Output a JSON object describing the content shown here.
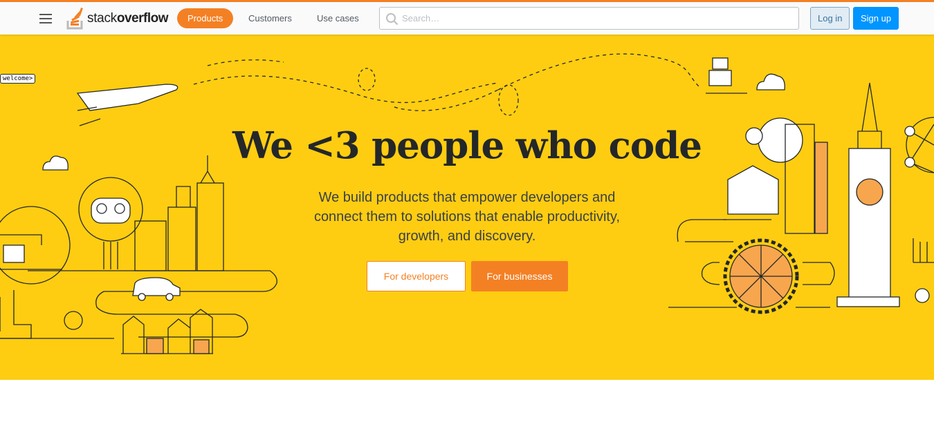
{
  "header": {
    "logo": {
      "part1": "stack",
      "part2": "overflow"
    },
    "nav": [
      {
        "label": "Products",
        "active": true
      },
      {
        "label": "Customers"
      },
      {
        "label": "Use cases"
      }
    ],
    "search": {
      "placeholder": "Search…",
      "value": ""
    },
    "login_label": "Log in",
    "signup_label": "Sign up"
  },
  "hero": {
    "title": "We <3 people who code",
    "subtitle": "We build products that empower developers and connect them to solutions that enable productivity, growth, and discovery.",
    "buttons": {
      "developers": "For developers",
      "businesses": "For businesses"
    },
    "welcome_tag": "welcome>"
  },
  "colors": {
    "accent": "#f48024",
    "hero_bg": "#fecd11",
    "signup": "#0095ff"
  }
}
